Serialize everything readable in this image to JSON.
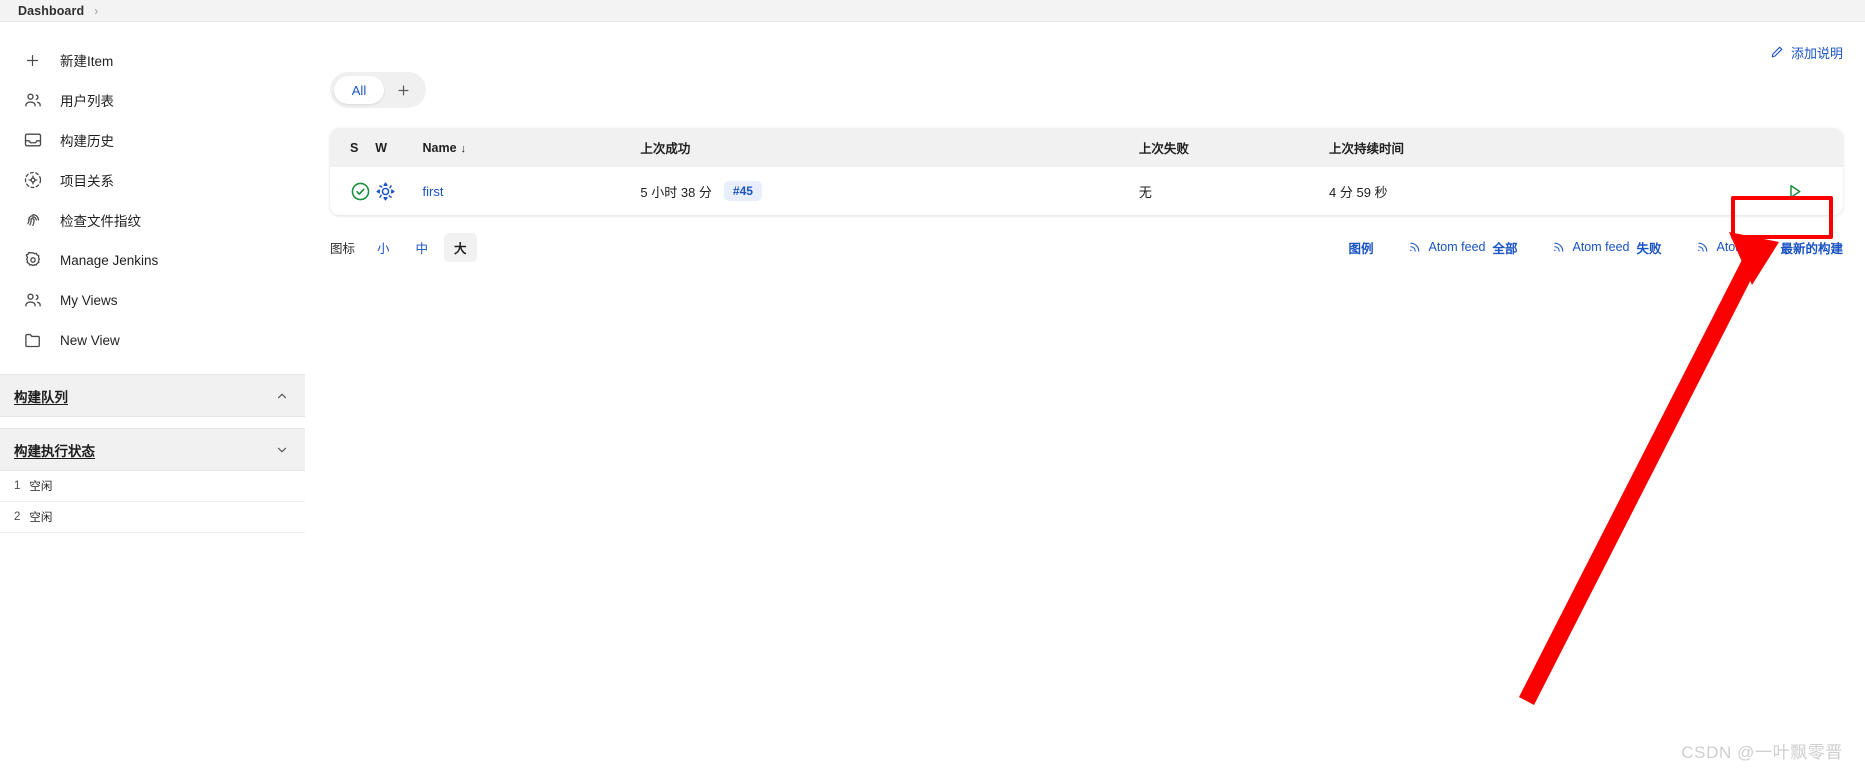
{
  "breadcrumb": {
    "root": "Dashboard",
    "separator": "›"
  },
  "sidebar": {
    "items": [
      {
        "label": "新建Item",
        "icon": "plus-icon"
      },
      {
        "label": "用户列表",
        "icon": "people-icon"
      },
      {
        "label": "构建历史",
        "icon": "inbox-icon"
      },
      {
        "label": "项目关系",
        "icon": "relations-icon"
      },
      {
        "label": "检查文件指纹",
        "icon": "fingerprint-icon"
      },
      {
        "label": "Manage Jenkins",
        "icon": "gear-icon"
      },
      {
        "label": "My Views",
        "icon": "people-icon"
      },
      {
        "label": "New View",
        "icon": "folder-icon"
      }
    ],
    "build_queue": {
      "title": "构建队列",
      "collapsed": false
    },
    "executor_status": {
      "title": "构建执行状态",
      "collapsed": true
    },
    "executors": [
      {
        "num": "1",
        "state": "空闲"
      },
      {
        "num": "2",
        "state": "空闲"
      }
    ]
  },
  "main": {
    "add_description": "添加说明",
    "tabs": [
      {
        "label": "All",
        "active": true
      }
    ],
    "add_tab_label": "+",
    "table": {
      "headers": {
        "s": "S",
        "w": "W",
        "name": "Name",
        "sort_arrow": "↓",
        "last_success": "上次成功",
        "last_failure": "上次失败",
        "last_duration": "上次持续时间",
        "actions": ""
      },
      "rows": [
        {
          "status": "success",
          "weather": "sunny",
          "name": "first",
          "last_success": "5 小时 38 分",
          "last_success_build": "#45",
          "last_failure": "无",
          "last_duration": "4 分 59 秒",
          "action": "run-build"
        }
      ]
    },
    "footer": {
      "icon_label": "图标",
      "sizes": [
        {
          "label": "小",
          "active": false
        },
        {
          "label": "中",
          "active": false
        },
        {
          "label": "大",
          "active": true
        }
      ],
      "legend": "图例",
      "feeds": [
        {
          "prefix": "Atom feed",
          "scope": "全部"
        },
        {
          "prefix": "Atom feed",
          "scope": "失败"
        },
        {
          "prefix": "Atom feed",
          "scope": "最新的构建"
        }
      ]
    }
  },
  "watermark": "CSDN @一叶飘零晋",
  "colors": {
    "link": "#1a53c4",
    "success": "#1a8f3c",
    "weather": "#1a53c4",
    "annotation": "#fb0000",
    "panel": "#f1f1f1"
  }
}
